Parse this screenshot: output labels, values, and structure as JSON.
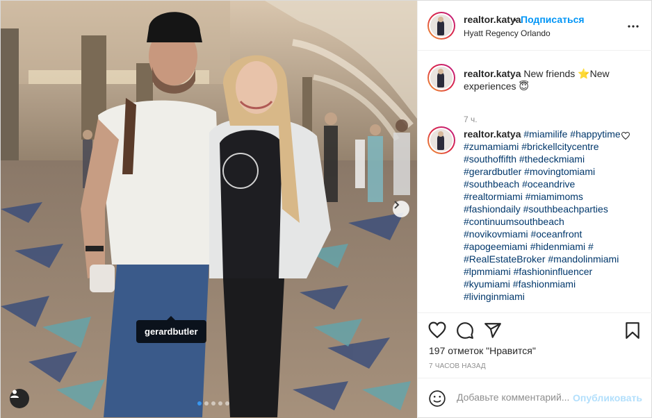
{
  "post": {
    "photo": {
      "tag_username": "gerardbutler",
      "carousel_total": 5,
      "carousel_active": 1
    },
    "header": {
      "username": "realtor.katya",
      "bullet": "•",
      "follow_label": "Подписаться",
      "location": "Hyatt Regency Orlando",
      "more_icon": "ellipsis-icon"
    },
    "caption": {
      "username": "realtor.katya",
      "text": "New friends ⭐New experiences 😇",
      "time": "7 ч."
    },
    "comment": {
      "username": "realtor.katya",
      "hashtags": "#miamilife #happytime #zumamiami #brickellcitycentre #southoffifth #thedeckmiami #gerardbutler #movingtomiami #southbeach #oceandrive #realtormiami #miamimoms #fashiondaily #southbeachparties #continuumsouthbeach #novikovmiami #oceanfront #apogeemiami #hidenmiami # #RealEstateBroker #mandolinmiami #lpmmiami #fashioninfluencer #kyumiami #fashionmiami #livinginmiami"
    },
    "actions": {
      "like_icon": "heart-icon",
      "comment_icon": "comment-bubble-icon",
      "share_icon": "paper-plane-icon",
      "save_icon": "bookmark-icon",
      "likes_text": "197 отметок \"Нравится\"",
      "time_ago": "7 ЧАСОВ НАЗАД"
    },
    "add_comment": {
      "placeholder": "Добавьте комментарий...",
      "post_label": "Опубликовать"
    },
    "colors": {
      "link_blue": "#0095f6",
      "post_disabled": "#b2dffc",
      "hashtag": "#00376b",
      "muted": "#8e8e8e"
    }
  }
}
